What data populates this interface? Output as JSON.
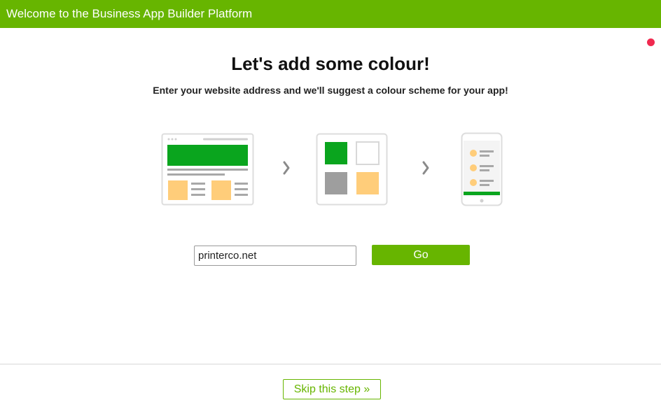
{
  "header": {
    "title": "Welcome to the Business App Builder Platform"
  },
  "main": {
    "heading": "Let's add some colour!",
    "subheading": "Enter your website address and we'll suggest a colour scheme for your app!",
    "website_input": {
      "value": "printerco.net",
      "placeholder": ""
    },
    "go_label": "Go"
  },
  "footer": {
    "skip_label": "Skip this step »"
  },
  "icons": {
    "notification": "notification-dot-icon",
    "website": "website-mockup-icon",
    "arrow": "chevron-right-icon",
    "palette": "colour-palette-icon",
    "phone": "phone-app-icon"
  },
  "colors": {
    "brand_green": "#67b500",
    "illustration_green": "#0aa51e",
    "illustration_yellow": "#ffcd7a",
    "illustration_gray": "#9e9e9e",
    "notification_red": "#f0294f"
  }
}
